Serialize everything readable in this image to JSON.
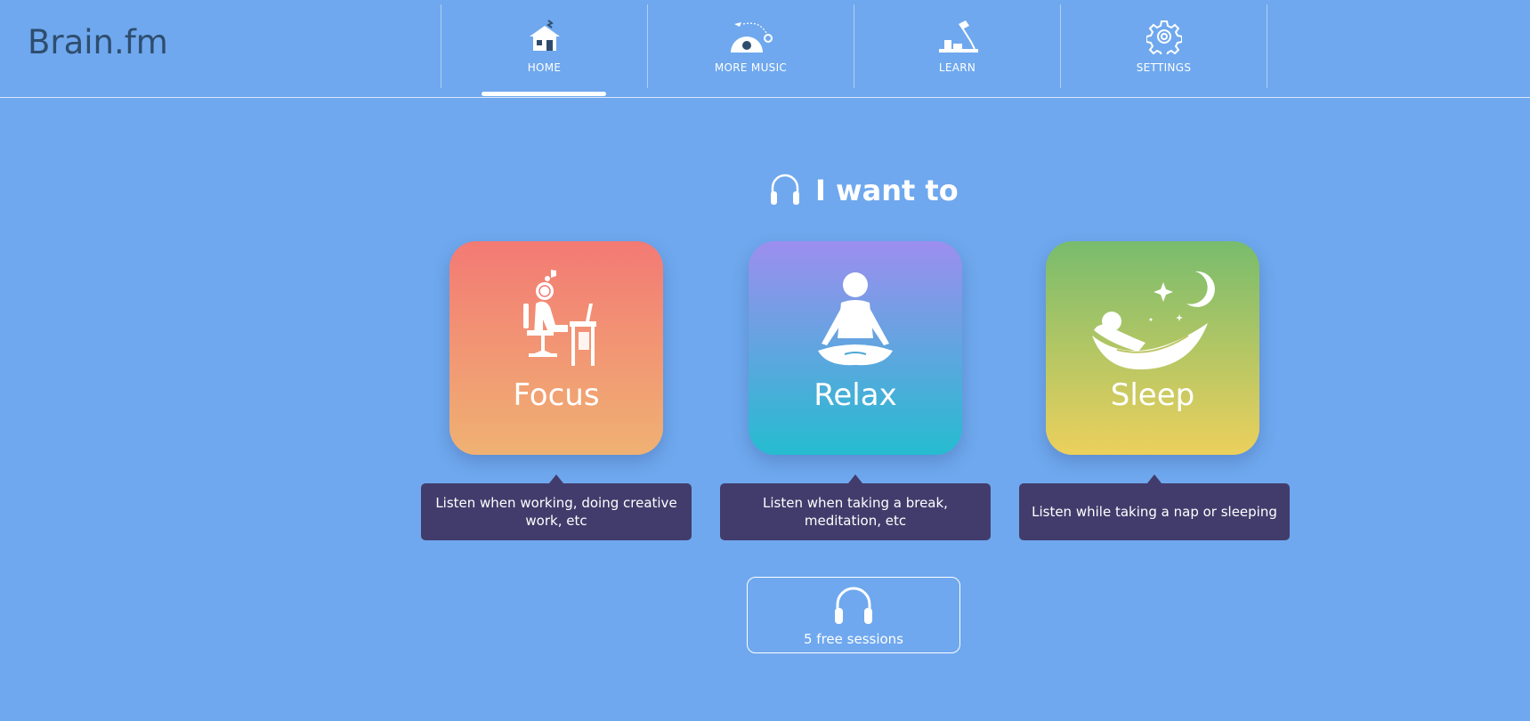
{
  "app": {
    "logo": "Brain.fm"
  },
  "nav": {
    "items": [
      {
        "label": "HOME",
        "icon": "house-icon",
        "active": true
      },
      {
        "label": "MORE MUSIC",
        "icon": "music-planet-icon",
        "active": false
      },
      {
        "label": "LEARN",
        "icon": "desk-lamp-icon",
        "active": false
      },
      {
        "label": "SETTINGS",
        "icon": "gear-icon",
        "active": false
      }
    ]
  },
  "main": {
    "heading": "I want to",
    "heading_icon": "headphones-icon",
    "modes": [
      {
        "label": "Focus",
        "icon": "person-at-desk-icon",
        "tooltip": "Listen when working, doing creative work, etc",
        "gradient": [
          "#f37a74",
          "#f0b173"
        ]
      },
      {
        "label": "Relax",
        "icon": "meditation-icon",
        "tooltip": "Listen when taking a break, meditation, etc",
        "gradient": [
          "#9d8eef",
          "#25bcd0"
        ]
      },
      {
        "label": "Sleep",
        "icon": "hammock-moon-icon",
        "tooltip": "Listen while taking a nap or sleeping",
        "gradient": [
          "#78bc6d",
          "#ecd05c"
        ]
      }
    ],
    "sessions": {
      "label": "5 free sessions",
      "icon": "headphones-icon"
    }
  },
  "colors": {
    "background": "#6fa8ee",
    "logo": "#2e4d6e",
    "tooltip": "#423c6c"
  }
}
